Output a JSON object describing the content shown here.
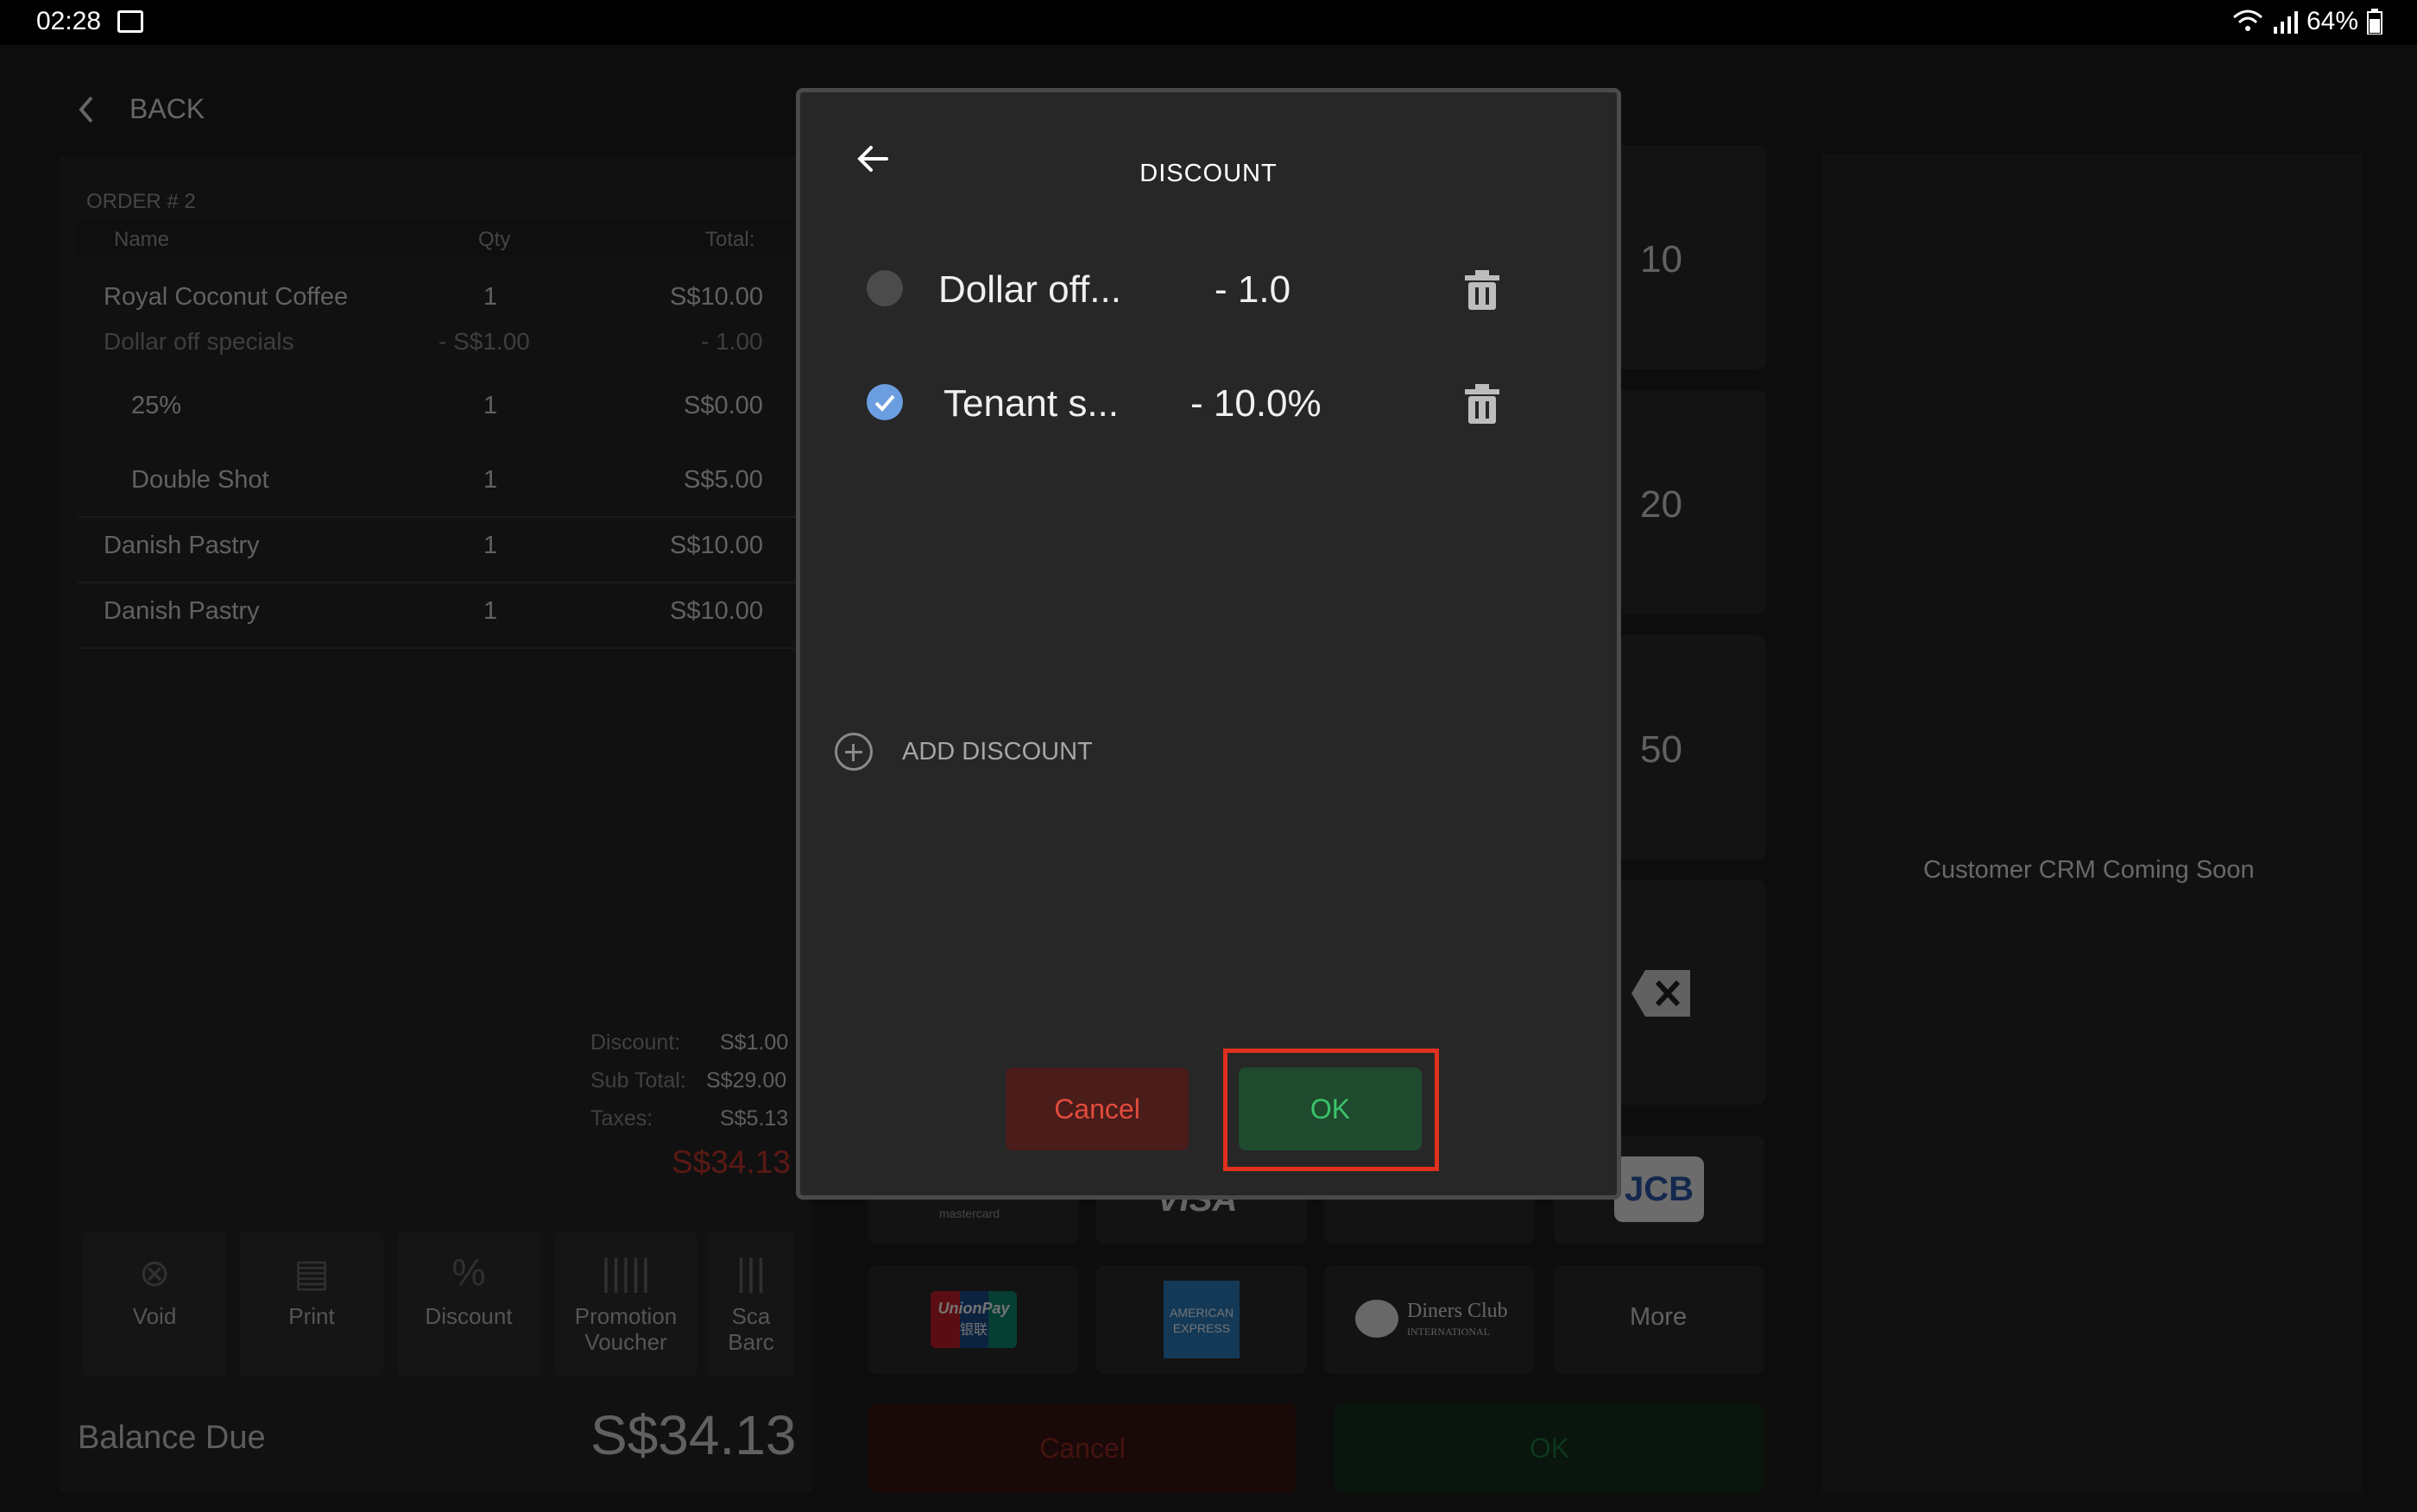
{
  "status_bar": {
    "time": "02:28",
    "battery": "64%"
  },
  "nav": {
    "back_label": "BACK"
  },
  "order": {
    "number": "ORDER # 2",
    "headers": {
      "name": "Name",
      "qty": "Qty",
      "total": "Total:"
    },
    "items": [
      {
        "name": "Royal Coconut Coffee",
        "qty": "1",
        "total": "S$10.00"
      },
      {
        "name": "Dollar off specials",
        "qty": "- S$1.00",
        "total": "- 1.00"
      },
      {
        "name": "25%",
        "qty": "1",
        "total": "S$0.00"
      },
      {
        "name": "Double Shot",
        "qty": "1",
        "total": "S$5.00"
      },
      {
        "name": "Danish Pastry",
        "qty": "1",
        "total": "S$10.00"
      },
      {
        "name": "Danish Pastry",
        "qty": "1",
        "total": "S$10.00"
      }
    ],
    "summary": {
      "discount_label": "Discount:",
      "discount_value": "S$1.00",
      "subtotal_label": "Sub Total:",
      "subtotal_value": "S$29.00",
      "taxes_label": "Taxes:",
      "taxes_value": "S$5.13",
      "total": "S$34.13"
    },
    "tools": [
      "Void",
      "Print",
      "Discount",
      "Promotion Voucher",
      "Sca Barc"
    ],
    "balance_label": "Balance Due",
    "balance_value": "S$34.13"
  },
  "tender": {
    "amounts": [
      "10",
      "20",
      "50"
    ],
    "cards": [
      "mastercard",
      "VISA",
      "",
      "JCB",
      "UnionPay",
      "AMERICAN EXPRESS",
      "Diners Club",
      "More"
    ],
    "diners_sub": "INTERNATIONAL",
    "unionpay_sub": "银联",
    "cancel_label": "Cancel",
    "ok_label": "OK"
  },
  "crm": {
    "message": "Customer CRM Coming Soon"
  },
  "dialog": {
    "title": "DISCOUNT",
    "discounts": [
      {
        "name": "Dollar off...",
        "value": "- 1.0",
        "selected": false
      },
      {
        "name": "Tenant s...",
        "value": "- 10.0%",
        "selected": true
      }
    ],
    "add_label": "ADD DISCOUNT",
    "cancel_label": "Cancel",
    "ok_label": "OK"
  },
  "colors": {
    "cancel_red": "#e24b3c",
    "ok_green": "#3ac46a",
    "total_red": "#c8382d",
    "highlight": "#e0301e",
    "radio_selected": "#6b9ee0"
  }
}
